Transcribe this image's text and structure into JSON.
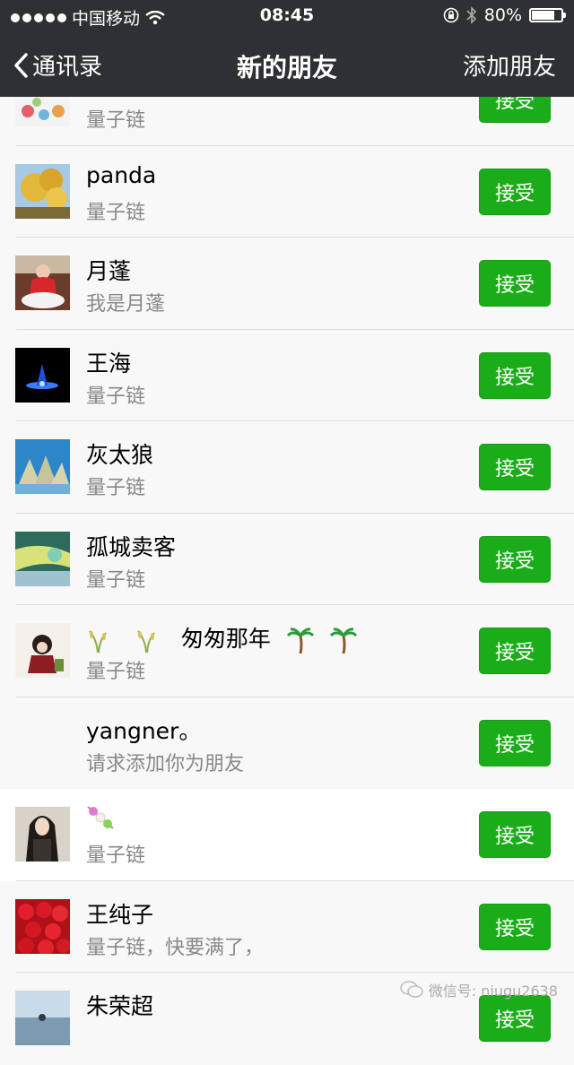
{
  "status_bar": {
    "carrier": "中国移动",
    "time": "08:45",
    "battery": "80%",
    "battery_level": 0.8
  },
  "nav": {
    "back_label": "通讯录",
    "title": "新的朋友",
    "right_label": "添加朋友"
  },
  "accept_label": "接受",
  "rows": [
    {
      "name": "",
      "subtitle": "量子链"
    },
    {
      "name": "panda",
      "subtitle": "量子链"
    },
    {
      "name": "月蓬",
      "subtitle": "我是月蓬"
    },
    {
      "name": "王海",
      "subtitle": "量子链"
    },
    {
      "name": "灰太狼",
      "subtitle": "量子链"
    },
    {
      "name": "孤城卖客",
      "subtitle": "量子链"
    },
    {
      "name": "匆匆那年",
      "subtitle": "量子链"
    },
    {
      "name": "yangner。",
      "subtitle": "请求添加你为朋友"
    },
    {
      "name": "",
      "subtitle": "量子链"
    },
    {
      "name": "王纯子",
      "subtitle": "量子链，快要满了，"
    },
    {
      "name": "朱荣超",
      "subtitle": ""
    }
  ],
  "watermark": "微信号: niugu2638"
}
